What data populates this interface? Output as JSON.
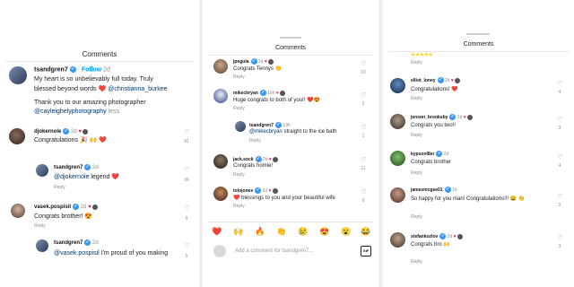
{
  "panel1": {
    "title": "Comments",
    "post": {
      "username": "tsandgren7",
      "follow": "Follow",
      "time": "2d",
      "line1": "My heart is so unbelievably full today. Truly",
      "line2a": "blessed beyond words ",
      "line2b": "@christianna_burkee",
      "line3": "Thank you to our amazing photographer",
      "line4a": "@cayleighelyphotography",
      "line4b": " less"
    },
    "comments": [
      {
        "user": "djokernole",
        "time": "2d",
        "text": "Congratulations 🎉 🙌 ❤️",
        "likes": "81"
      },
      {
        "user": "tsandgren7",
        "time": "2d",
        "text_mention": "@djokernole",
        "text": " legend ❤️",
        "reply": "Reply",
        "likes": "36"
      },
      {
        "user": "vasek.pospisil",
        "time": "2d",
        "text": "Congrats brother! 😍",
        "reply": "Reply",
        "likes": "9"
      },
      {
        "user": "tsandgren7",
        "time": "2d",
        "text_mention": "@vasek.pospisil",
        "text": " I'm proud of you making",
        "likes": "5"
      }
    ]
  },
  "panel2": {
    "title": "Comments",
    "comments": [
      {
        "user": "jpegula",
        "time": "1d",
        "text": "Congrats Tennys 👏",
        "reply": "Reply",
        "likes": "10"
      },
      {
        "user": "mikecbryan",
        "time": "16h",
        "text": "Huge congrats to both of you!! ❤️😍",
        "reply": "Reply",
        "likes": "2"
      },
      {
        "user": "tsandgren7",
        "time": "13h",
        "text_mention": "@mikecbryan",
        "text": " straight to the ice bath",
        "reply": "Reply",
        "likes": "1"
      },
      {
        "user": "jack.sock",
        "time": "2d",
        "text": "Congrats homie!",
        "reply": "Reply",
        "likes": "11"
      },
      {
        "user": "tolojones",
        "time": "2d",
        "text": "❤️ blessings to you and your beautiful wife",
        "reply": "Reply",
        "likes": "6"
      }
    ],
    "emojis": [
      "❤️",
      "🙌",
      "🔥",
      "👏",
      "😢",
      "😍",
      "😮",
      "😂"
    ],
    "input_placeholder": "Add a comment for tsandgren7...",
    "gif": "GIF"
  },
  "panel3": {
    "title": "Comments",
    "top_stars": "⭐⭐⭐⭐⭐",
    "top_reply": "Reply",
    "comments": [
      {
        "user": "elliot_loney",
        "time": "2d",
        "text": "Congratulations! ❤️",
        "reply": "Reply",
        "likes": "4"
      },
      {
        "user": "jenson_brooksby",
        "time": "2d",
        "text": "Congrats you two!!",
        "reply": "Reply",
        "likes": "3"
      },
      {
        "user": "kypsonl8er",
        "time": "2d",
        "text": "Congrats brother",
        "reply": "Reply",
        "likes": "4"
      },
      {
        "user": "jamesmcgee01",
        "time": "1d",
        "text": "So happy for you man! Congratulations!!! 😀 👏",
        "reply": "Reply",
        "likes": "2"
      },
      {
        "user": "stefankozlov",
        "time": "2d",
        "text": "Congrats bro 🙌",
        "reply": "Reply",
        "likes": "3"
      }
    ]
  }
}
